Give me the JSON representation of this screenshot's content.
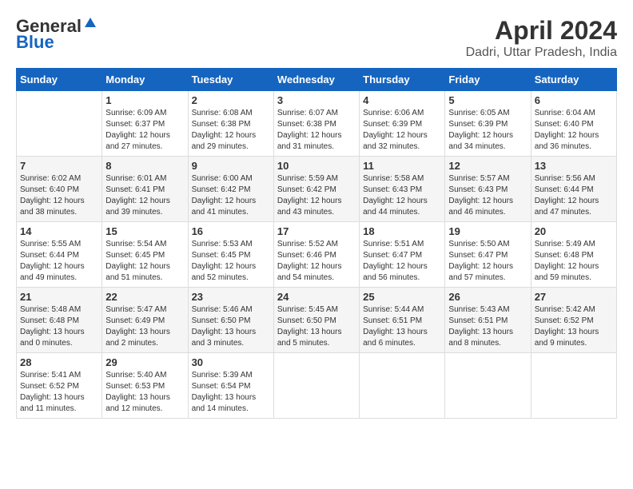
{
  "header": {
    "logo_line1": "General",
    "logo_line2": "Blue",
    "title": "April 2024",
    "subtitle": "Dadri, Uttar Pradesh, India"
  },
  "days_of_week": [
    "Sunday",
    "Monday",
    "Tuesday",
    "Wednesday",
    "Thursday",
    "Friday",
    "Saturday"
  ],
  "weeks": [
    [
      {
        "day": "",
        "info": ""
      },
      {
        "day": "1",
        "info": "Sunrise: 6:09 AM\nSunset: 6:37 PM\nDaylight: 12 hours\nand 27 minutes."
      },
      {
        "day": "2",
        "info": "Sunrise: 6:08 AM\nSunset: 6:38 PM\nDaylight: 12 hours\nand 29 minutes."
      },
      {
        "day": "3",
        "info": "Sunrise: 6:07 AM\nSunset: 6:38 PM\nDaylight: 12 hours\nand 31 minutes."
      },
      {
        "day": "4",
        "info": "Sunrise: 6:06 AM\nSunset: 6:39 PM\nDaylight: 12 hours\nand 32 minutes."
      },
      {
        "day": "5",
        "info": "Sunrise: 6:05 AM\nSunset: 6:39 PM\nDaylight: 12 hours\nand 34 minutes."
      },
      {
        "day": "6",
        "info": "Sunrise: 6:04 AM\nSunset: 6:40 PM\nDaylight: 12 hours\nand 36 minutes."
      }
    ],
    [
      {
        "day": "7",
        "info": "Sunrise: 6:02 AM\nSunset: 6:40 PM\nDaylight: 12 hours\nand 38 minutes."
      },
      {
        "day": "8",
        "info": "Sunrise: 6:01 AM\nSunset: 6:41 PM\nDaylight: 12 hours\nand 39 minutes."
      },
      {
        "day": "9",
        "info": "Sunrise: 6:00 AM\nSunset: 6:42 PM\nDaylight: 12 hours\nand 41 minutes."
      },
      {
        "day": "10",
        "info": "Sunrise: 5:59 AM\nSunset: 6:42 PM\nDaylight: 12 hours\nand 43 minutes."
      },
      {
        "day": "11",
        "info": "Sunrise: 5:58 AM\nSunset: 6:43 PM\nDaylight: 12 hours\nand 44 minutes."
      },
      {
        "day": "12",
        "info": "Sunrise: 5:57 AM\nSunset: 6:43 PM\nDaylight: 12 hours\nand 46 minutes."
      },
      {
        "day": "13",
        "info": "Sunrise: 5:56 AM\nSunset: 6:44 PM\nDaylight: 12 hours\nand 47 minutes."
      }
    ],
    [
      {
        "day": "14",
        "info": "Sunrise: 5:55 AM\nSunset: 6:44 PM\nDaylight: 12 hours\nand 49 minutes."
      },
      {
        "day": "15",
        "info": "Sunrise: 5:54 AM\nSunset: 6:45 PM\nDaylight: 12 hours\nand 51 minutes."
      },
      {
        "day": "16",
        "info": "Sunrise: 5:53 AM\nSunset: 6:45 PM\nDaylight: 12 hours\nand 52 minutes."
      },
      {
        "day": "17",
        "info": "Sunrise: 5:52 AM\nSunset: 6:46 PM\nDaylight: 12 hours\nand 54 minutes."
      },
      {
        "day": "18",
        "info": "Sunrise: 5:51 AM\nSunset: 6:47 PM\nDaylight: 12 hours\nand 56 minutes."
      },
      {
        "day": "19",
        "info": "Sunrise: 5:50 AM\nSunset: 6:47 PM\nDaylight: 12 hours\nand 57 minutes."
      },
      {
        "day": "20",
        "info": "Sunrise: 5:49 AM\nSunset: 6:48 PM\nDaylight: 12 hours\nand 59 minutes."
      }
    ],
    [
      {
        "day": "21",
        "info": "Sunrise: 5:48 AM\nSunset: 6:48 PM\nDaylight: 13 hours\nand 0 minutes."
      },
      {
        "day": "22",
        "info": "Sunrise: 5:47 AM\nSunset: 6:49 PM\nDaylight: 13 hours\nand 2 minutes."
      },
      {
        "day": "23",
        "info": "Sunrise: 5:46 AM\nSunset: 6:50 PM\nDaylight: 13 hours\nand 3 minutes."
      },
      {
        "day": "24",
        "info": "Sunrise: 5:45 AM\nSunset: 6:50 PM\nDaylight: 13 hours\nand 5 minutes."
      },
      {
        "day": "25",
        "info": "Sunrise: 5:44 AM\nSunset: 6:51 PM\nDaylight: 13 hours\nand 6 minutes."
      },
      {
        "day": "26",
        "info": "Sunrise: 5:43 AM\nSunset: 6:51 PM\nDaylight: 13 hours\nand 8 minutes."
      },
      {
        "day": "27",
        "info": "Sunrise: 5:42 AM\nSunset: 6:52 PM\nDaylight: 13 hours\nand 9 minutes."
      }
    ],
    [
      {
        "day": "28",
        "info": "Sunrise: 5:41 AM\nSunset: 6:52 PM\nDaylight: 13 hours\nand 11 minutes."
      },
      {
        "day": "29",
        "info": "Sunrise: 5:40 AM\nSunset: 6:53 PM\nDaylight: 13 hours\nand 12 minutes."
      },
      {
        "day": "30",
        "info": "Sunrise: 5:39 AM\nSunset: 6:54 PM\nDaylight: 13 hours\nand 14 minutes."
      },
      {
        "day": "",
        "info": ""
      },
      {
        "day": "",
        "info": ""
      },
      {
        "day": "",
        "info": ""
      },
      {
        "day": "",
        "info": ""
      }
    ]
  ]
}
